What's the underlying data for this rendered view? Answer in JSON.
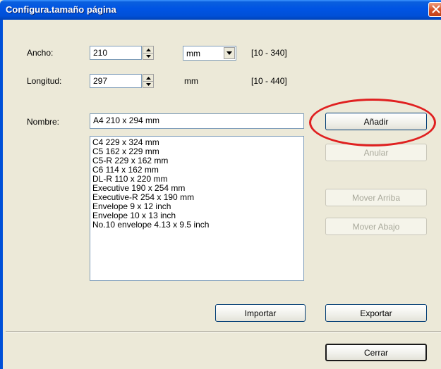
{
  "window": {
    "title": "Configura.tamaño página"
  },
  "width": {
    "label": "Ancho:",
    "value": "210",
    "unit_selected": "mm",
    "range": "[10 - 340]"
  },
  "length": {
    "label": "Longitud:",
    "value": "297",
    "unit": "mm",
    "range": "[10 - 440]"
  },
  "name": {
    "label": "Nombre:",
    "value": "A4 210 x 294 mm"
  },
  "paper_list": [
    "C4 229 x 324 mm",
    "C5 162 x 229 mm",
    "C5-R 229 x 162 mm",
    "C6 114 x 162 mm",
    "DL-R 110 x 220 mm",
    "Executive 190 x 254 mm",
    "Executive-R 254 x 190 mm",
    "Envelope 9 x 12 inch",
    "Envelope 10 x 13 inch",
    "No.10 envelope 4.13 x 9.5 inch"
  ],
  "buttons": {
    "add": "Añadir",
    "cancel": "Anular",
    "move_up": "Mover Arriba",
    "move_down": "Mover Abajo",
    "import": "Importar",
    "export": "Exportar",
    "close": "Cerrar"
  },
  "colors": {
    "titlebar": "#0054e3",
    "dialog_bg": "#ece9d8",
    "highlight_ring": "#e02020"
  },
  "icons": [
    "close-icon",
    "spin-up-icon",
    "spin-down-icon",
    "dropdown-arrow-icon"
  ]
}
